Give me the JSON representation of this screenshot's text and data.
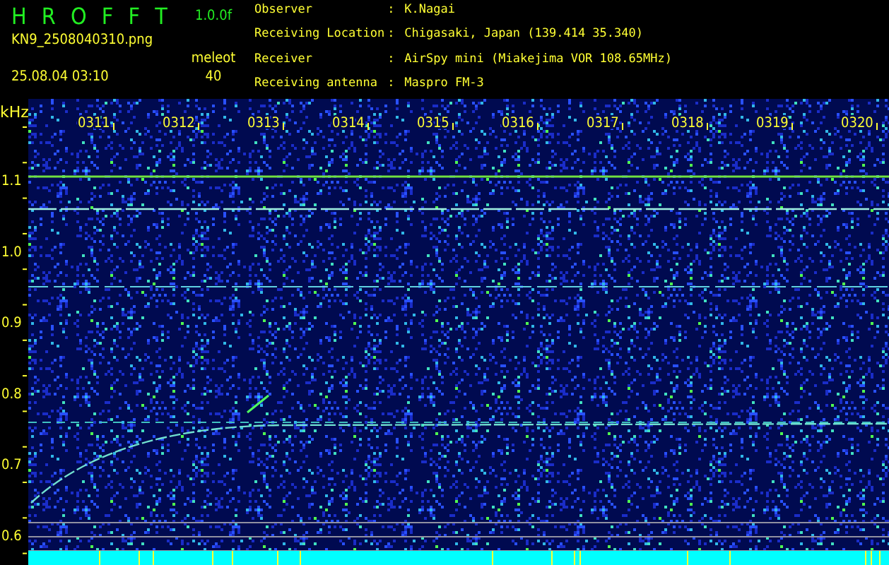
{
  "header": {
    "app_title": "H R O F F T",
    "version": "1.0.0f",
    "file_name": "KN9_2508040310.png",
    "date_time": "25.08.04 03:10",
    "mode_label": "meleot",
    "mode_value": "40"
  },
  "station_info": [
    {
      "label": "Observer",
      "separator": ":",
      "value": "K.Nagai"
    },
    {
      "label": "Receiving Location",
      "separator": ":",
      "value": "Chigasaki, Japan (139.414 35.340)"
    },
    {
      "label": "Receiver",
      "separator": ":",
      "value": "AirSpy mini (Miakejima VOR 108.65MHz)"
    },
    {
      "label": "Receiving antenna",
      "separator": ":",
      "value": "Maspro FM-3"
    }
  ],
  "plot": {
    "y_unit": "kHz",
    "y_labels": [
      "1.1",
      "1.0",
      "0.9",
      "0.8",
      "0.7",
      "0.6"
    ],
    "time_labels": [
      "0311",
      "0312",
      "0313",
      "0314",
      "0315",
      "0316",
      "0317",
      "0318",
      "0319",
      "0320"
    ]
  }
}
